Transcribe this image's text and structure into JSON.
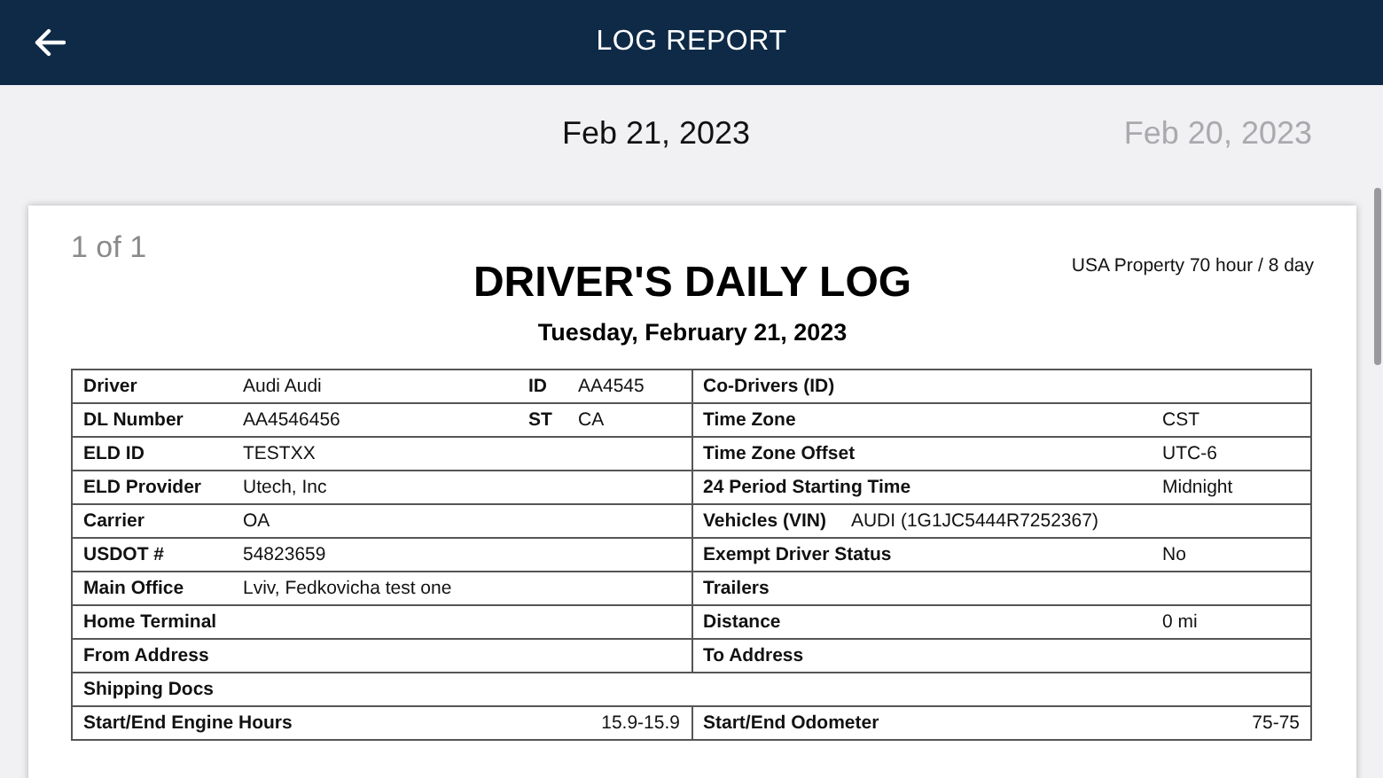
{
  "header": {
    "title": "LOG REPORT"
  },
  "date_nav": {
    "current": "Feb 21, 2023",
    "next": "Feb 20, 2023"
  },
  "report": {
    "page": "1 of 1",
    "title": "DRIVER'S DAILY LOG",
    "date": "Tuesday, February 21, 2023",
    "ruleset": "USA Property 70 hour / 8 day",
    "rows": [
      {
        "kind": "split",
        "left": {
          "kind": "columns",
          "label": "Driver",
          "value": "Audi Audi",
          "extra_label": "ID",
          "extra_value": "AA4545"
        },
        "right": {
          "kind": "columns",
          "label": "Co-Drivers (ID)"
        }
      },
      {
        "kind": "split",
        "left": {
          "kind": "columns",
          "label": "DL Number",
          "value": "AA4546456",
          "extra_label": "ST",
          "extra_value": "CA"
        },
        "right": {
          "kind": "columns",
          "label": "Time Zone",
          "value": "CST"
        }
      },
      {
        "kind": "split",
        "left": {
          "kind": "columns",
          "label": "ELD ID",
          "value": "TESTXX"
        },
        "right": {
          "kind": "columns",
          "label": "Time Zone Offset",
          "value": "UTC-6"
        }
      },
      {
        "kind": "split",
        "left": {
          "kind": "columns",
          "label": "ELD Provider",
          "value": "Utech, Inc"
        },
        "right": {
          "kind": "columns",
          "label": "24 Period Starting Time",
          "value": "Midnight"
        }
      },
      {
        "kind": "split",
        "left": {
          "kind": "columns",
          "label": "Carrier",
          "value": "OA"
        },
        "right": {
          "kind": "inline",
          "label": "Vehicles (VIN)",
          "value": "AUDI (1G1JC5444R7252367)"
        }
      },
      {
        "kind": "split",
        "left": {
          "kind": "columns",
          "label": "USDOT #",
          "value": "54823659"
        },
        "right": {
          "kind": "columns",
          "label": "Exempt Driver Status",
          "value": "No"
        }
      },
      {
        "kind": "split",
        "left": {
          "kind": "columns",
          "label": "Main Office",
          "value": "Lviv, Fedkovicha test one"
        },
        "right": {
          "kind": "columns",
          "label": "Trailers"
        }
      },
      {
        "kind": "split",
        "left": {
          "kind": "columns",
          "label": "Home Terminal"
        },
        "right": {
          "kind": "columns",
          "label": "Distance",
          "value": "0 mi"
        }
      },
      {
        "kind": "split",
        "left": {
          "kind": "columns",
          "label": "From Address"
        },
        "right": {
          "kind": "columns",
          "label": "To Address"
        }
      },
      {
        "kind": "full",
        "left": {
          "kind": "columns",
          "label": "Shipping Docs"
        }
      },
      {
        "kind": "split",
        "left": {
          "kind": "end",
          "label": "Start/End Engine Hours",
          "value": "15.9-15.9"
        },
        "right": {
          "kind": "end",
          "label": "Start/End Odometer",
          "value": "75-75"
        }
      }
    ]
  }
}
